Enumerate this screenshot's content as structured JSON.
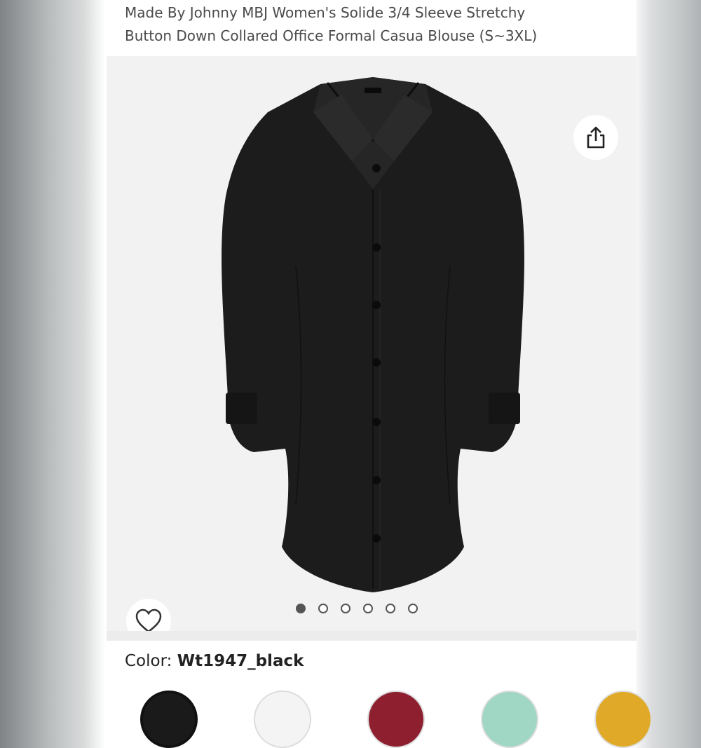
{
  "product": {
    "title_line1": "Made By Johnny MBJ Women's Solide 3/4 Sleeve Stretchy",
    "title_line2": "Button Down Collared Office Formal Casua Blouse (S~3XL)"
  },
  "gallery": {
    "image_alt": "Black 3/4 sleeve button down collared blouse",
    "share_icon": "share-icon",
    "favorite_icon": "heart-icon",
    "dot_count": 6,
    "active_dot": 1
  },
  "color": {
    "label": "Color: ",
    "value": "Wt1947_black",
    "swatches": [
      "#1a1a1a",
      "#f4f4f4",
      "#8e1f2e",
      "#9fd6c4",
      "#e0a928"
    ]
  }
}
